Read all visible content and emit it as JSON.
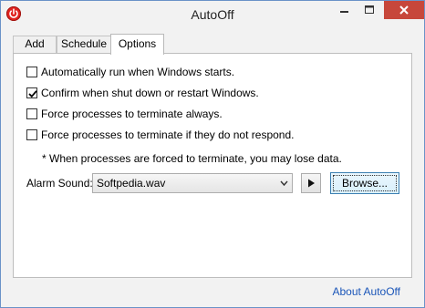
{
  "window": {
    "title": "AutoOff",
    "icon": "power-icon",
    "controls": [
      "minimize-icon",
      "maximize-icon",
      "close-icon"
    ]
  },
  "tabs": [
    {
      "label": "Add",
      "active": false
    },
    {
      "label": "Schedule",
      "active": false
    },
    {
      "label": "Options",
      "active": true
    }
  ],
  "options": {
    "checkboxes": [
      {
        "label": "Automatically run when Windows starts.",
        "checked": false
      },
      {
        "label": "Confirm when shut down or restart Windows.",
        "checked": true
      },
      {
        "label": "Force processes to terminate always.",
        "checked": false
      },
      {
        "label": "Force processes to terminate if they do not respond.",
        "checked": false
      }
    ],
    "note": "* When processes are forced to terminate, you may lose data.",
    "alarm_sound_label": "Alarm Sound:",
    "alarm_sound_value": "Softpedia.wav",
    "play_icon": "play-icon",
    "browse_label": "Browse..."
  },
  "footer": {
    "about_link": "About AutoOff"
  },
  "colors": {
    "close_button": "#c7473b",
    "link": "#1a55b8",
    "app_icon": "#e0231f",
    "window_border": "#6a92c8"
  }
}
